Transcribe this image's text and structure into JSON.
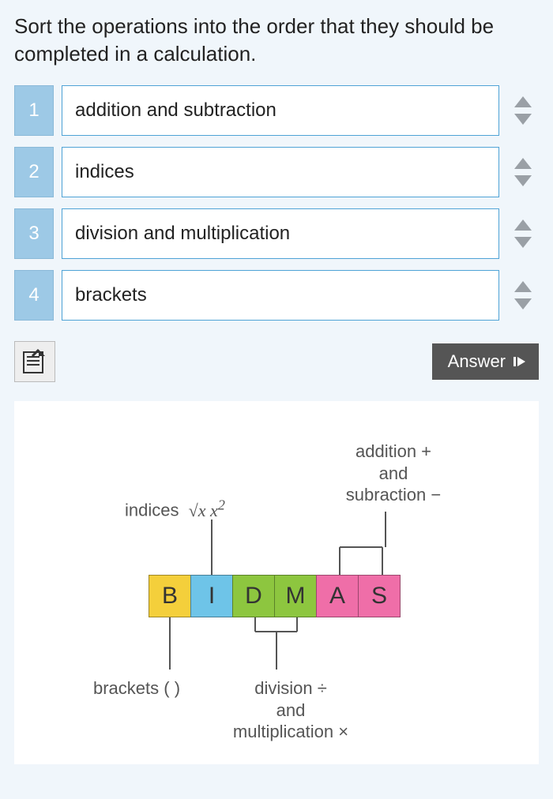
{
  "prompt": "Sort the operations into the order that they should be completed in a calculation.",
  "items": [
    {
      "rank": "1",
      "label": "addition and subtraction"
    },
    {
      "rank": "2",
      "label": "indices"
    },
    {
      "rank": "3",
      "label": "division and multiplication"
    },
    {
      "rank": "4",
      "label": "brackets"
    }
  ],
  "answer_button": "Answer",
  "diagram": {
    "tiles": {
      "b": "B",
      "i": "I",
      "d": "D",
      "m": "M",
      "a": "A",
      "s": "S"
    },
    "indices_label": "indices",
    "indices_symbols": "√x x²",
    "addsub_line1": "addition +",
    "addsub_line2": "and",
    "addsub_line3": "subraction −",
    "brackets_label": "brackets ( )",
    "divmul_line1": "division ÷",
    "divmul_line2": "and",
    "divmul_line3": "multiplication ×"
  }
}
